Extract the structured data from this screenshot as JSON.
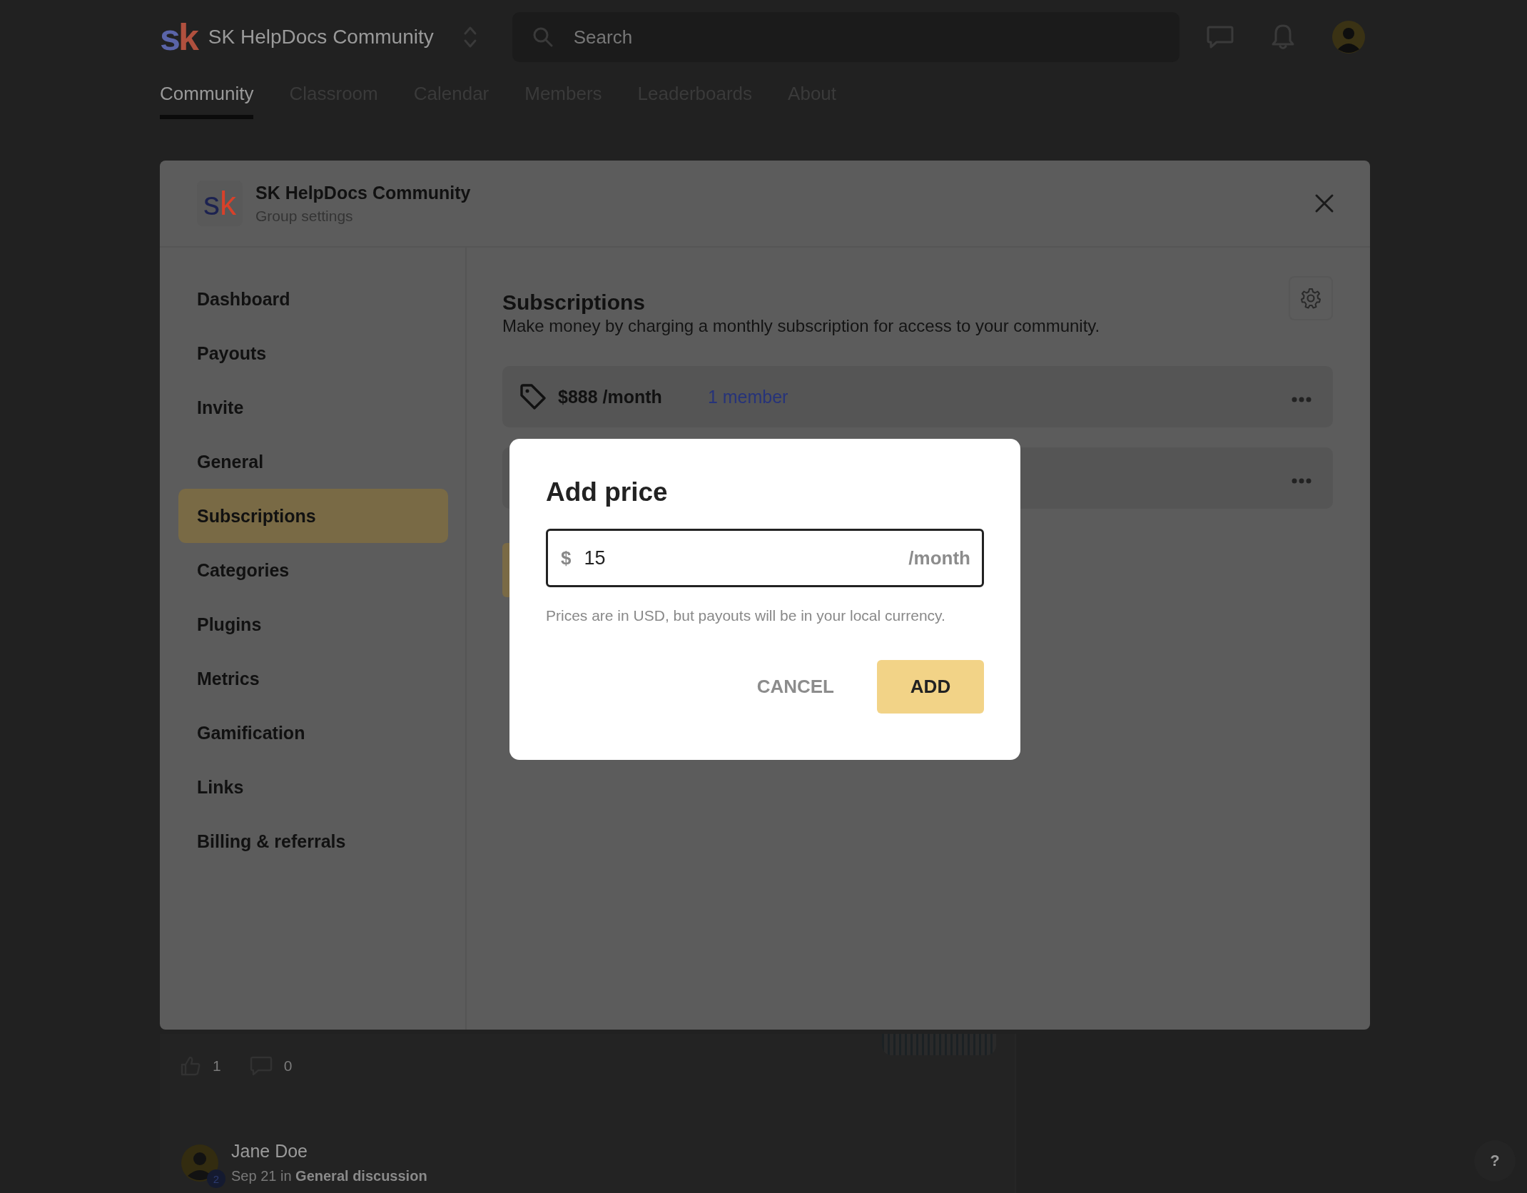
{
  "topbar": {
    "logo_text": "sk",
    "community_name": "SK HelpDocs Community",
    "search": {
      "placeholder": "Search"
    }
  },
  "tabs": [
    {
      "label": "Community",
      "selected": true
    },
    {
      "label": "Classroom",
      "selected": false
    },
    {
      "label": "Calendar",
      "selected": false
    },
    {
      "label": "Members",
      "selected": false
    },
    {
      "label": "Leaderboards",
      "selected": false
    },
    {
      "label": "About",
      "selected": false
    }
  ],
  "settings": {
    "logo_text": "sk",
    "title": "SK HelpDocs Community",
    "subtitle": "Group settings",
    "menu": [
      {
        "label": "Dashboard",
        "selected": false
      },
      {
        "label": "Payouts",
        "selected": false
      },
      {
        "label": "Invite",
        "selected": false
      },
      {
        "label": "General",
        "selected": false
      },
      {
        "label": "Subscriptions",
        "selected": true
      },
      {
        "label": "Categories",
        "selected": false
      },
      {
        "label": "Plugins",
        "selected": false
      },
      {
        "label": "Metrics",
        "selected": false
      },
      {
        "label": "Gamification",
        "selected": false
      },
      {
        "label": "Links",
        "selected": false
      },
      {
        "label": "Billing & referrals",
        "selected": false
      }
    ],
    "heading": "Subscriptions",
    "description": "Make money by charging a monthly subscription for access to your community.",
    "price": {
      "amount": "$888 /month",
      "members": "1 member"
    }
  },
  "dialog": {
    "title": "Add price",
    "currency": "$",
    "value": "15",
    "suffix": "/month",
    "hint": "Prices are in USD, but payouts will be in your local currency.",
    "buttons": [
      {
        "label": "CANCEL",
        "kind": "text"
      },
      {
        "label": "ADD",
        "kind": "primary"
      }
    ]
  },
  "feed": {
    "likes": "1",
    "comments": "0",
    "post": {
      "author": "Jane Doe",
      "badge": "2",
      "date": "Sep 21",
      "joiner": "in",
      "category": "General discussion"
    }
  },
  "help": "?"
}
